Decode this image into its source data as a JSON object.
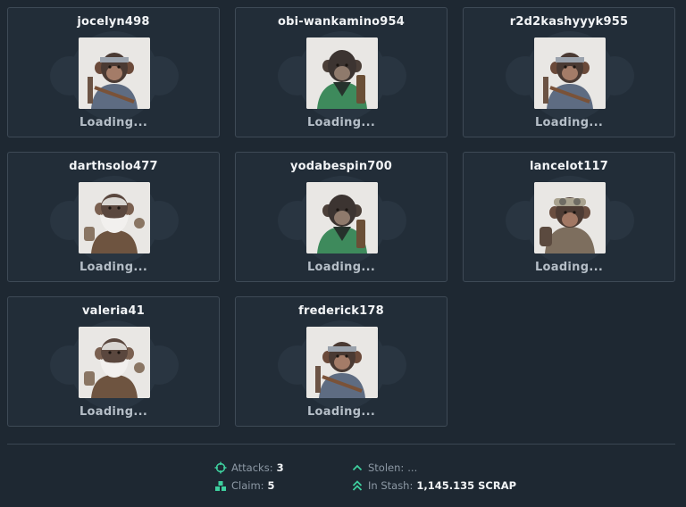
{
  "cards": [
    {
      "username": "jocelyn498",
      "status": "Loading...",
      "avatar": "ape-headband-shotgun",
      "avatar_icon": "ape-avatar-icon"
    },
    {
      "username": "obi-wankamino954",
      "status": "Loading...",
      "avatar": "ape-green-jacket",
      "avatar_icon": "ape-avatar-icon"
    },
    {
      "username": "r2d2kashyyyk955",
      "status": "Loading...",
      "avatar": "ape-headband-shotgun",
      "avatar_icon": "ape-avatar-icon"
    },
    {
      "username": "darthsolo477",
      "status": "Loading...",
      "avatar": "ape-white-beard",
      "avatar_icon": "ape-avatar-icon"
    },
    {
      "username": "yodabespin700",
      "status": "Loading...",
      "avatar": "ape-green-jacket",
      "avatar_icon": "ape-avatar-icon"
    },
    {
      "username": "lancelot117",
      "status": "Loading...",
      "avatar": "ape-goggles",
      "avatar_icon": "ape-avatar-icon"
    },
    {
      "username": "valeria41",
      "status": "Loading...",
      "avatar": "ape-white-beard",
      "avatar_icon": "ape-avatar-icon"
    },
    {
      "username": "frederick178",
      "status": "Loading...",
      "avatar": "ape-headband-shotgun",
      "avatar_icon": "ape-avatar-icon"
    }
  ],
  "stats": {
    "attacks_label": "Attacks:",
    "attacks_value": "3",
    "claim_label": "Claim:",
    "claim_value": "5",
    "stolen_label": "Stolen:",
    "stolen_value": "...",
    "stash_label": "In Stash:",
    "stash_value": "1,145.135 SCRAP",
    "icons": {
      "attacks": "crosshair-icon",
      "claim": "coins-stack-icon",
      "stolen": "chevron-up-icon",
      "stash": "double-chevron-up-icon"
    }
  },
  "colors": {
    "background": "#1e2832",
    "card_background": "#222d38",
    "card_border": "#3e4a56",
    "accent": "#3ecf9e",
    "muted_text": "#8d99a5",
    "status_text": "#b6bfc8"
  }
}
